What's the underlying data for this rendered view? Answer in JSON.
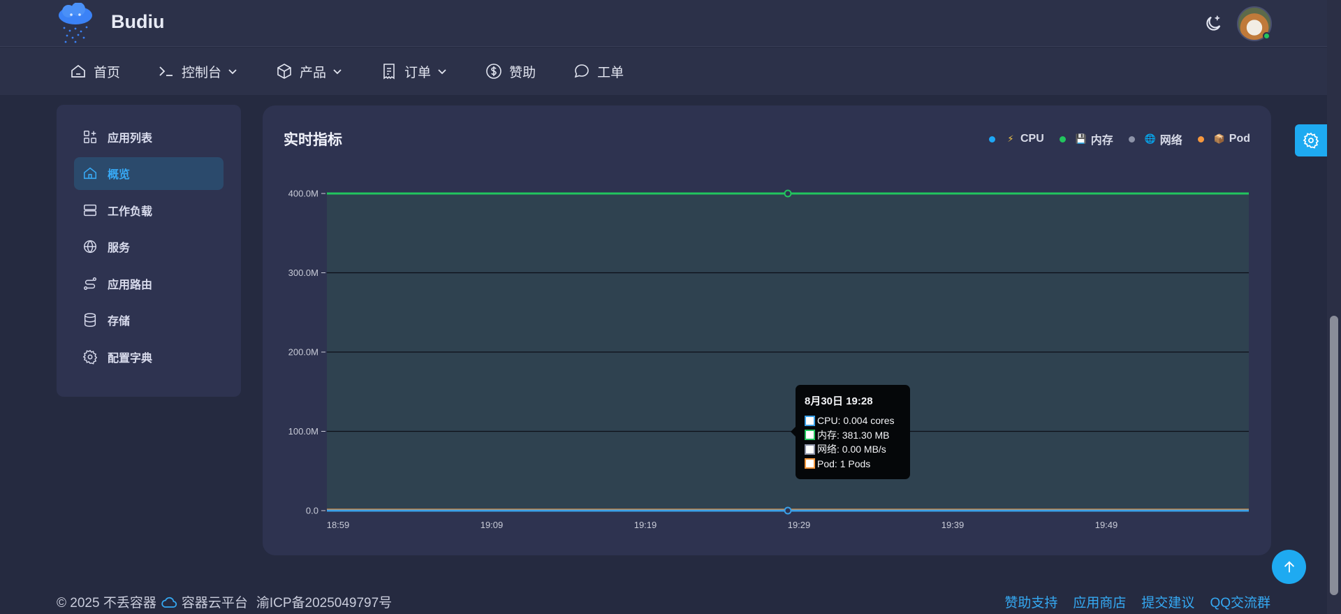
{
  "brand": {
    "name": "Budiu"
  },
  "nav": [
    {
      "label": "首页",
      "icon": "home-icon",
      "has_dropdown": false
    },
    {
      "label": "控制台",
      "icon": "terminal-icon",
      "has_dropdown": true
    },
    {
      "label": "产品",
      "icon": "box-icon",
      "has_dropdown": true
    },
    {
      "label": "订单",
      "icon": "receipt-icon",
      "has_dropdown": true
    },
    {
      "label": "赞助",
      "icon": "dollar-icon",
      "has_dropdown": false
    },
    {
      "label": "工单",
      "icon": "chat-icon",
      "has_dropdown": false
    }
  ],
  "sidebar": {
    "items": [
      {
        "label": "应用列表",
        "icon": "apps-icon",
        "active": false
      },
      {
        "label": "概览",
        "icon": "home-icon",
        "active": true
      },
      {
        "label": "工作负载",
        "icon": "server-icon",
        "active": false
      },
      {
        "label": "服务",
        "icon": "globe-icon",
        "active": false
      },
      {
        "label": "应用路由",
        "icon": "route-icon",
        "active": false
      },
      {
        "label": "存储",
        "icon": "database-icon",
        "active": false
      },
      {
        "label": "配置字典",
        "icon": "gear-icon",
        "active": false
      }
    ]
  },
  "card": {
    "title": "实时指标"
  },
  "chart_data": {
    "type": "line",
    "x": [
      "18:59",
      "19:09",
      "19:19",
      "19:29",
      "19:39",
      "19:49"
    ],
    "ylim": [
      0,
      400
    ],
    "yticks": [
      "0.0",
      "100.0M",
      "200.0M",
      "300.0M",
      "400.0M"
    ],
    "series": [
      {
        "name": "CPU",
        "icon": "⚡",
        "color": "#3aa0e8",
        "values": [
          0.004,
          0.004,
          0.004,
          0.004,
          0.004,
          0.004,
          0.004
        ]
      },
      {
        "name": "内存",
        "icon": "💾",
        "color": "#22c55e",
        "values": [
          400,
          400,
          400,
          400,
          400,
          400,
          400
        ]
      },
      {
        "name": "网络",
        "icon": "🌐",
        "color": "#8d93a8",
        "values": [
          0,
          0,
          0,
          0,
          0,
          0,
          0
        ]
      },
      {
        "name": "Pod",
        "icon": "📦",
        "color": "#f6983e",
        "values": [
          1,
          1,
          1,
          1,
          1,
          1,
          1
        ]
      }
    ],
    "grid": true,
    "legend_position": "top-right",
    "tooltip": {
      "title": "8月30日 19:28",
      "rows": [
        {
          "label": "CPU: 0.004 cores",
          "color": "#3aa0e8"
        },
        {
          "label": "内存: 381.30 MB",
          "color": "#22c55e"
        },
        {
          "label": "网络: 0.00 MB/s",
          "color": "#8d93a8"
        },
        {
          "label": "Pod: 1 Pods",
          "color": "#f6983e"
        }
      ]
    }
  },
  "footer": {
    "copyright": "© 2025 不丢容器",
    "platform": "容器云平台",
    "icp": "渝ICP备2025049797号",
    "links": [
      "赞助支持",
      "应用商店",
      "提交建议",
      "QQ交流群"
    ]
  },
  "colors": {
    "accent": "#1eaaf1",
    "active_text": "#37a9f5",
    "memory_line": "#22c55e",
    "cpu_line": "#3aa0e8"
  }
}
